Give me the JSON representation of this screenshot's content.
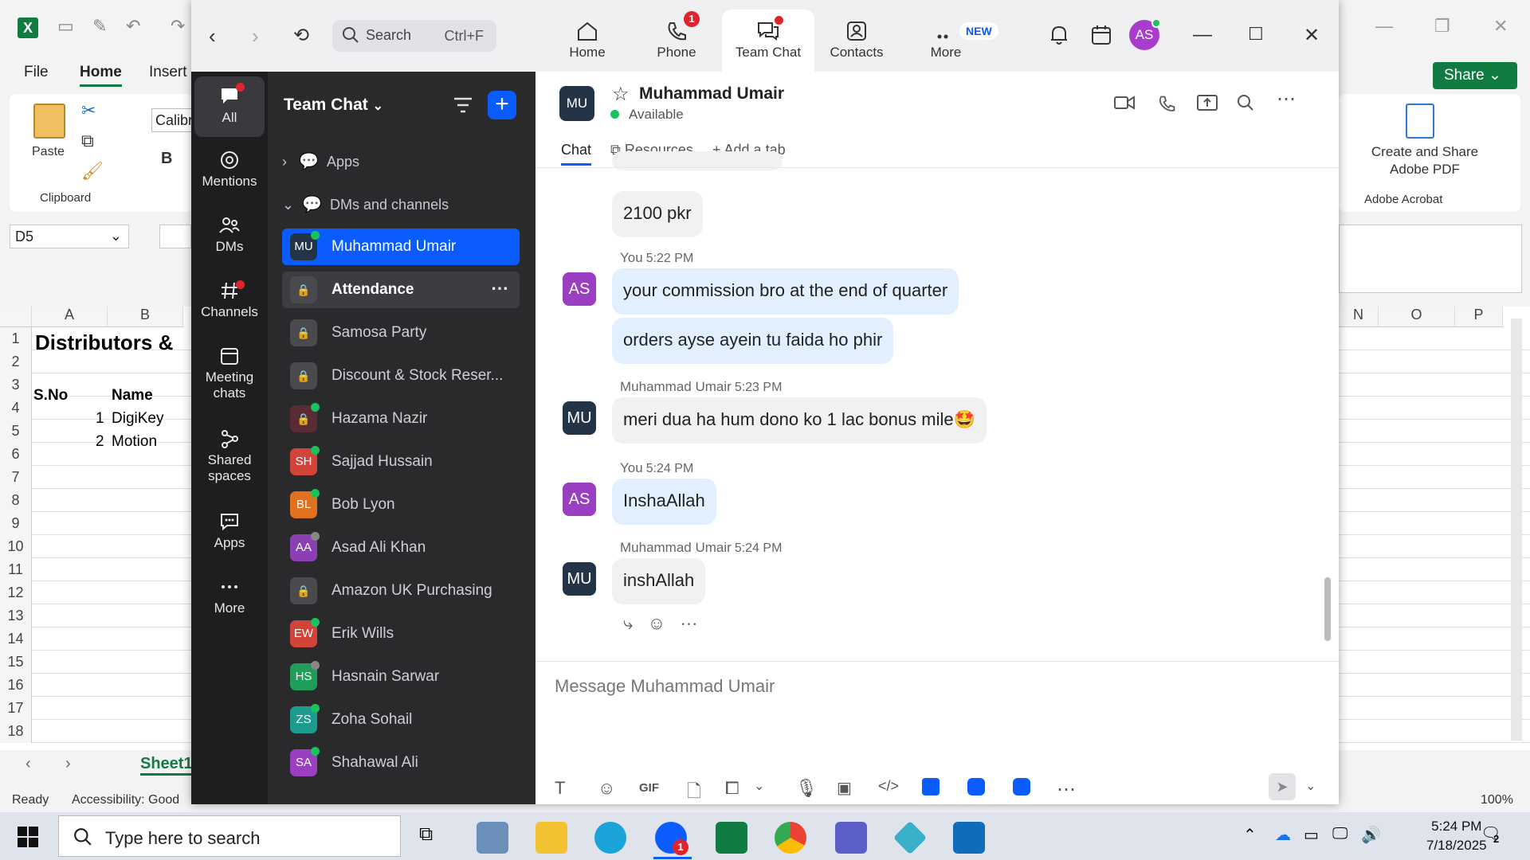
{
  "excel": {
    "tabs": [
      "File",
      "Home",
      "Insert"
    ],
    "share_label": "Share",
    "ribbon": {
      "paste_label": "Paste",
      "clipboard_label": "Clipboard",
      "font_name": "Calibr",
      "bold_label": "B",
      "create_share_label": "Create and Share Adobe PDF",
      "adobe_label": "Adobe Acrobat"
    },
    "name_box": "D5",
    "columns_left": [
      "A",
      "B"
    ],
    "columns_right": [
      "N",
      "O",
      "P"
    ],
    "rows": [
      "1",
      "2",
      "3",
      "4",
      "5",
      "6",
      "7",
      "8",
      "9",
      "10",
      "11",
      "12",
      "13",
      "14",
      "15",
      "16",
      "17",
      "18"
    ],
    "title_cell": "Distributors &",
    "header_sno": "S.No",
    "header_name": "Name",
    "rows_data": [
      {
        "sno": "1",
        "name": "DigiKey"
      },
      {
        "sno": "2",
        "name": "Motion"
      }
    ],
    "sheet_tab": "Sheet1",
    "status_ready": "Ready",
    "status_accessibility": "Accessibility: Good",
    "zoom_level": "100%"
  },
  "zoom": {
    "search": {
      "placeholder": "Search",
      "shortcut": "Ctrl+F"
    },
    "top_tabs": [
      {
        "label": "Home",
        "icon": "home-icon"
      },
      {
        "label": "Phone",
        "icon": "phone-icon",
        "badge": "1"
      },
      {
        "label": "Team Chat",
        "icon": "chat-icon"
      },
      {
        "label": "Contacts",
        "icon": "contacts-icon"
      },
      {
        "label": "More",
        "icon": "more-icon",
        "new_badge": "NEW"
      }
    ],
    "user_avatar": "AS",
    "rail": [
      {
        "label": "All"
      },
      {
        "label": "Mentions"
      },
      {
        "label": "DMs"
      },
      {
        "label": "Channels"
      },
      {
        "label": "Meeting chats"
      },
      {
        "label": "Shared spaces"
      },
      {
        "label": "Apps"
      },
      {
        "label": "More"
      }
    ],
    "list_title": "Team Chat",
    "sections": {
      "apps": "Apps",
      "dms": "DMs and channels"
    },
    "channels": [
      {
        "name": "Muhammad Umair",
        "initials": "MU",
        "color": "#243447"
      },
      {
        "name": "Attendance",
        "initials": "",
        "color": "#4a4a4e"
      },
      {
        "name": "Samosa Party",
        "initials": "",
        "color": "#4a4a4e"
      },
      {
        "name": "Discount & Stock Reser...",
        "initials": "",
        "color": "#4a4a4e"
      },
      {
        "name": "Hazama Nazir",
        "initials": "",
        "color": "#5a2b35"
      },
      {
        "name": "Sajjad Hussain",
        "initials": "SH",
        "color": "#d2443a"
      },
      {
        "name": "Bob Lyon",
        "initials": "BL",
        "color": "#e0711e"
      },
      {
        "name": "Asad Ali Khan",
        "initials": "AA",
        "color": "#8a3fb5"
      },
      {
        "name": "Amazon UK Purchasing",
        "initials": "",
        "color": "#4a4a4e"
      },
      {
        "name": "Erik Wills",
        "initials": "EW",
        "color": "#d2443a"
      },
      {
        "name": "Hasnain Sarwar",
        "initials": "HS",
        "color": "#1f9d59"
      },
      {
        "name": "Zoha Sohail",
        "initials": "ZS",
        "color": "#1c9b8e"
      },
      {
        "name": "Shahawal Ali",
        "initials": "SA",
        "color": "#9a3fc2"
      }
    ],
    "chat": {
      "contact_initials": "MU",
      "contact_name": "Muhammad Umair",
      "contact_status": "Available",
      "subtabs": [
        "Chat",
        "Resources",
        "Add a tab"
      ],
      "messages": [
        {
          "sender": "",
          "time": "",
          "text": "2100 pkr",
          "mine": false
        },
        {
          "sender": "You",
          "time": "5:22 PM",
          "text": "your commission bro at the end of quarter",
          "mine": true
        },
        {
          "sender": "",
          "time": "",
          "text": "orders ayse ayein tu faida ho phir",
          "mine": true
        },
        {
          "sender": "Muhammad Umair",
          "time": "5:23 PM",
          "text": "meri dua ha hum dono ko 1 lac bonus mile🤩",
          "mine": false
        },
        {
          "sender": "You",
          "time": "5:24 PM",
          "text": "InshaAllah",
          "mine": true
        },
        {
          "sender": "Muhammad Umair",
          "time": "5:24 PM",
          "text": "inshAllah",
          "mine": false
        }
      ],
      "avatar_me": "AS",
      "avatar_them": "MU",
      "input_placeholder": "Message Muhammad Umair",
      "gif_label": "GIF"
    }
  },
  "taskbar": {
    "search_placeholder": "Type here to search",
    "time": "5:24 PM",
    "date": "7/18/2025",
    "notification_count": "2",
    "zoom_badge": "1"
  },
  "colors": {
    "accent": "#0b5cff",
    "excel_green": "#107c41",
    "rail_bg": "#1e1e21",
    "list_bg": "#2a2a2d",
    "badge_red": "#e0242d",
    "online_green": "#1bc15a"
  }
}
